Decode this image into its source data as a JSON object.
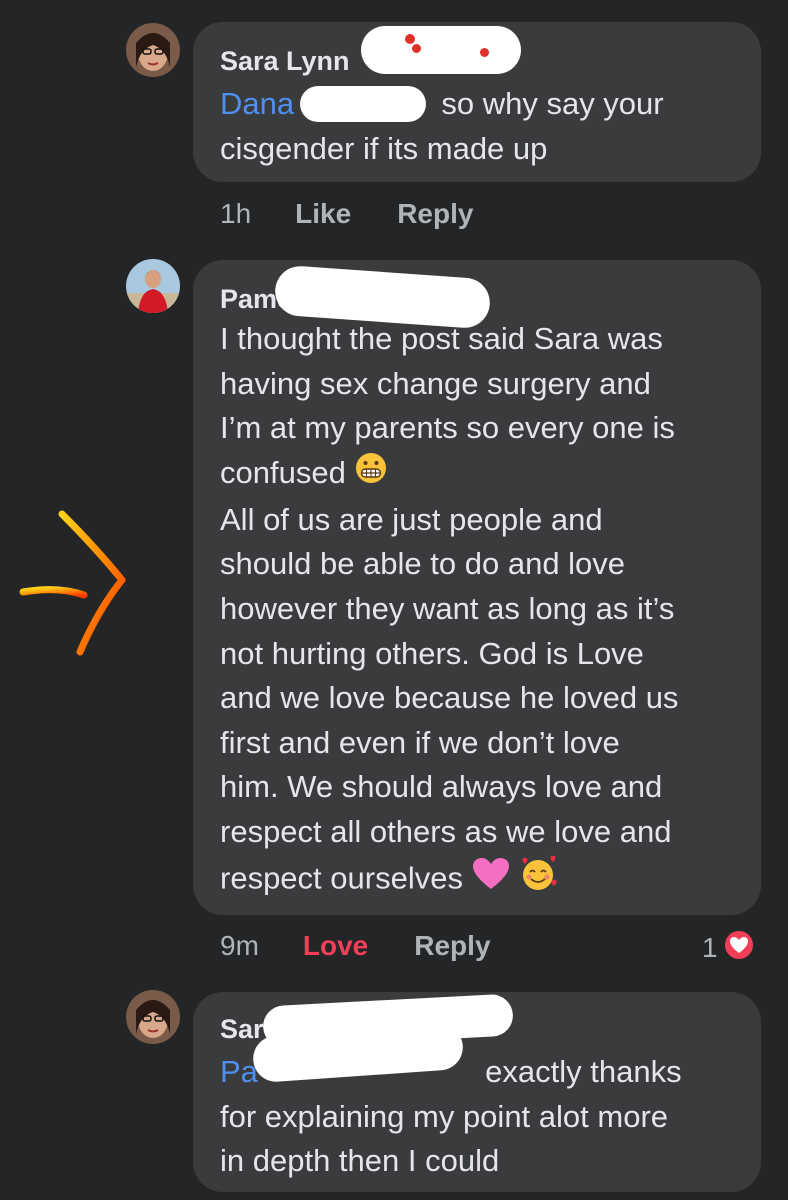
{
  "comments": [
    {
      "author": "Sara Lynn",
      "mention": "Dana",
      "text": "so why say your cisgender if its made up",
      "line1": "so why say your",
      "line2": "cisgender if its made up",
      "time": "1h",
      "like": "Like",
      "reply": "Reply"
    },
    {
      "author": "Pame",
      "lines": [
        "I thought the post said Sara was",
        "having sex change surgery and",
        "I’m at my parents so every one is",
        "confused",
        "All of us are just people and",
        "should be able to do and love",
        "however they want as long as it’s",
        "not hurting others.  God is Love",
        "and we love because he loved us",
        "first and even if we don’t love",
        "him.  We should always love and",
        "respect all others as we love and",
        "respect ourselves"
      ],
      "time": "9m",
      "reaction_label": "Love",
      "reply": "Reply",
      "reaction_count": "1"
    },
    {
      "author": "Sar",
      "mention": "Pa",
      "line1": "exactly thanks",
      "line2": "for explaining my point alot more",
      "line3": "in depth then I could"
    }
  ],
  "colors": {
    "background": "#242526",
    "bubble": "#3a3b3c",
    "mention": "#4e8ff0",
    "love": "#f33e58",
    "meta": "#b0b3b8",
    "arrow": "#ff8a00"
  },
  "icons": [
    "grimacing-face-emoji",
    "pink-heart-emoji",
    "smiling-face-with-hearts-emoji",
    "love-reaction-icon",
    "hand-drawn-arrow"
  ]
}
